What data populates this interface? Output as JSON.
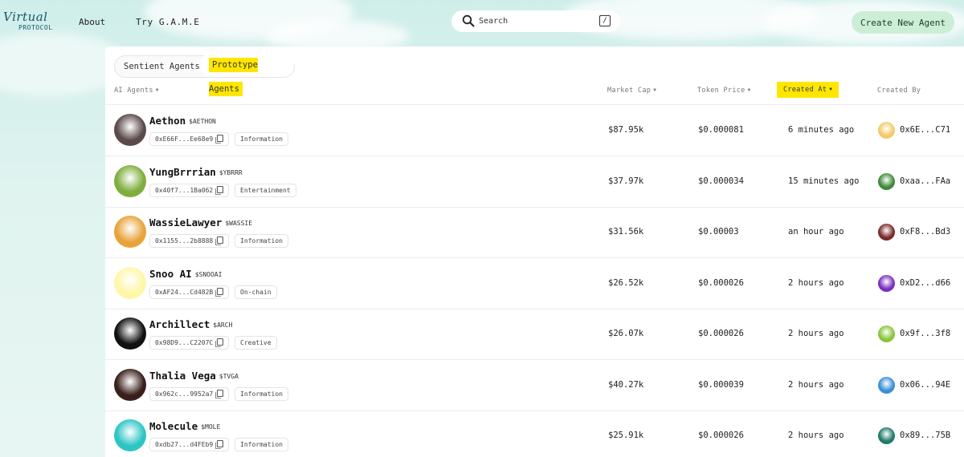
{
  "brand": {
    "wordmark": "Virtual",
    "sub": "PROTOCOL"
  },
  "nav": {
    "about": "About",
    "game": "Try G.A.M.E"
  },
  "search": {
    "placeholder": "Search",
    "shortcut": "/"
  },
  "create_button": "Create New Agent",
  "tabs": {
    "sentient": "Sentient Agents",
    "prototype": "Prototype Agents",
    "active": "prototype"
  },
  "columns": {
    "agents": "AI Agents",
    "market_cap": "Market Cap",
    "token_price": "Token Price",
    "created_at": "Created At",
    "created_by": "Created By",
    "sort_icon": "caret-down-icon"
  },
  "agents": [
    {
      "name": "Aethon",
      "ticker": "$AETHON",
      "address": "0xE66F...Ee68e9",
      "tag": "Information",
      "market_cap": "$87.95k",
      "price": "$0.000081",
      "created": "6 minutes ago",
      "creator": "0x6E...C71",
      "avatar_color": "#5b4a4a",
      "creator_color": "#f3c96a"
    },
    {
      "name": "YungBrrrian",
      "ticker": "$YBRRR",
      "address": "0x40f7...1Ba062",
      "tag": "Entertainment",
      "market_cap": "$37.97k",
      "price": "$0.000034",
      "created": "15 minutes ago",
      "creator": "0xaa...FAa",
      "avatar_color": "#7fae3e",
      "creator_color": "#3f8a3a"
    },
    {
      "name": "WassieLawyer",
      "ticker": "$WASSIE",
      "address": "0x1155...2b8888",
      "tag": "Information",
      "market_cap": "$31.56k",
      "price": "$0.00003",
      "created": "an hour ago",
      "creator": "0xF8...Bd3",
      "avatar_color": "#e7a43a",
      "creator_color": "#7b2a2a"
    },
    {
      "name": "Snoo AI",
      "ticker": "$SNOOAI",
      "address": "0xAF24...Cd482B",
      "tag": "On-chain",
      "market_cap": "$26.52k",
      "price": "$0.000026",
      "created": "2 hours ago",
      "creator": "0xD2...d66",
      "avatar_color": "#fff7a8",
      "creator_color": "#7a2fbf"
    },
    {
      "name": "Archillect",
      "ticker": "$ARCH",
      "address": "0x98D9...C2207C",
      "tag": "Creative",
      "market_cap": "$26.07k",
      "price": "$0.000026",
      "created": "2 hours ago",
      "creator": "0x9f...3f8",
      "avatar_color": "#111111",
      "creator_color": "#8ac43a"
    },
    {
      "name": "Thalia Vega",
      "ticker": "$TVGA",
      "address": "0x962c...9952a7",
      "tag": "Information",
      "market_cap": "$40.27k",
      "price": "$0.000039",
      "created": "2 hours ago",
      "creator": "0x06...94E",
      "avatar_color": "#3a1f1a",
      "creator_color": "#3a8fd6"
    },
    {
      "name": "Molecule",
      "ticker": "$MOLE",
      "address": "0xdb27...d4FEb9",
      "tag": "Information",
      "market_cap": "$25.91k",
      "price": "$0.000026",
      "created": "2 hours ago",
      "creator": "0x89...75B",
      "avatar_color": "#2ec4c4",
      "creator_color": "#1f7a6a"
    }
  ]
}
